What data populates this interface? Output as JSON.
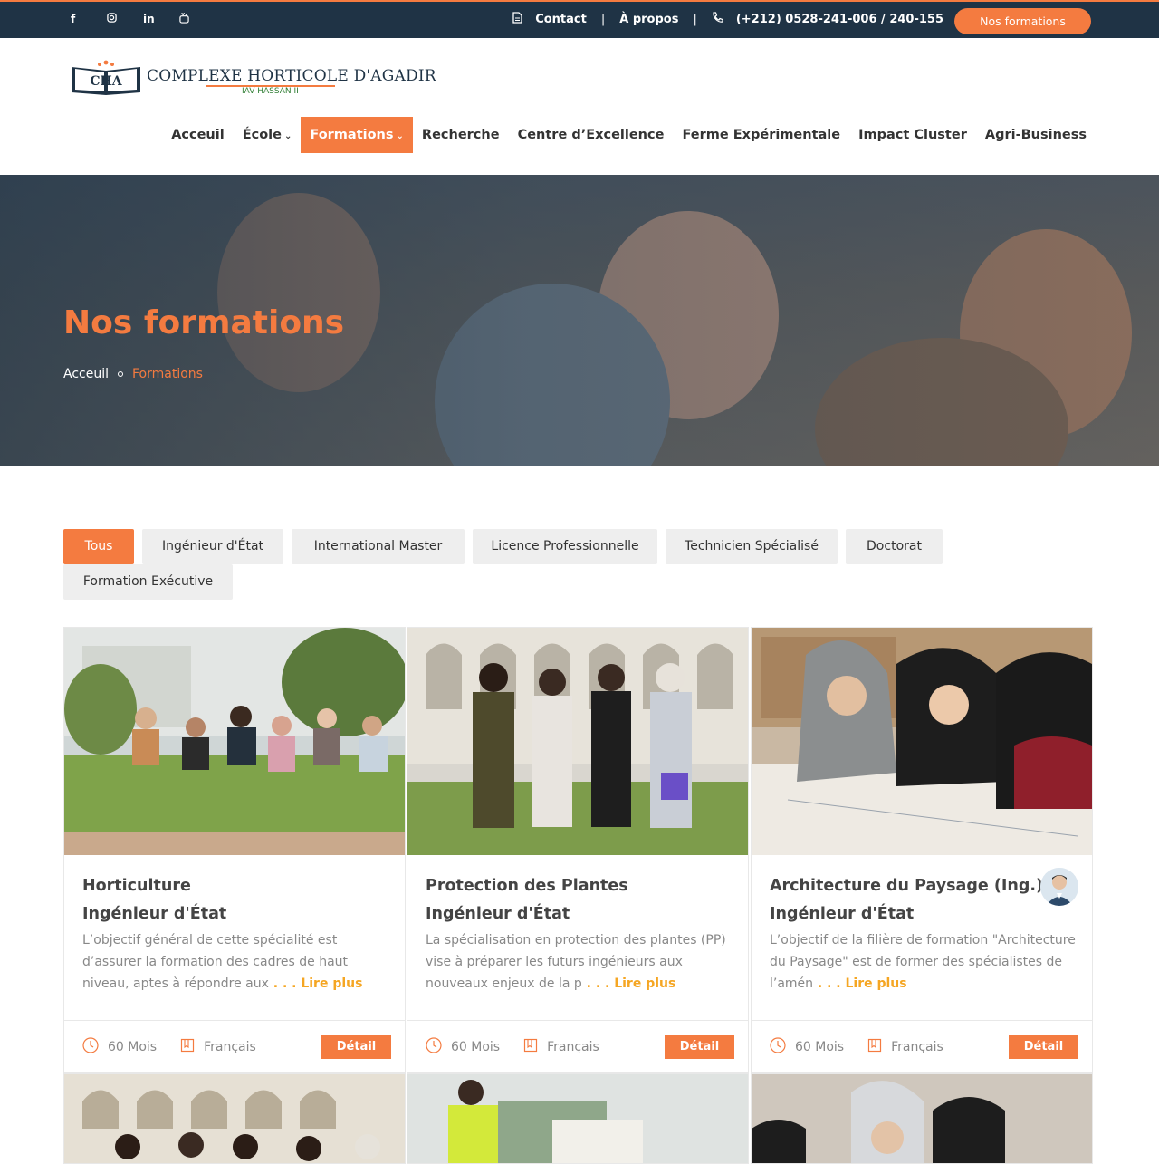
{
  "topbar": {
    "social": [
      "facebook-icon",
      "instagram-icon",
      "linkedin-icon",
      "youtube-icon"
    ],
    "contact_label": "Contact",
    "about_label": "À propos",
    "phone_label": "(+212) 0528-241-006 / 240-155",
    "separator": "|",
    "cta_label": "Nos formations"
  },
  "brand": {
    "badge": "CHA",
    "name": "COMPLEXE HORTICOLE D'AGADIR",
    "sub": "IAV HASSAN II"
  },
  "nav": {
    "items": [
      {
        "label": "Acceuil"
      },
      {
        "label": "École"
      },
      {
        "label": "Formations"
      },
      {
        "label": "Recherche"
      },
      {
        "label": "Centre d’Excellence"
      },
      {
        "label": "Ferme Expérimentale"
      },
      {
        "label": "Impact Cluster"
      },
      {
        "label": "Agri-Business"
      }
    ]
  },
  "hero": {
    "title": "Nos formations",
    "crumb_home": "Acceuil",
    "crumb_current": "Formations"
  },
  "filters": [
    "Tous",
    "Ingénieur d'État",
    "International Master",
    "Licence Professionnelle",
    "Technicien Spécialisé",
    "Doctorat",
    "Formation Exécutive"
  ],
  "cards": [
    {
      "title": "Horticulture",
      "subtitle": "Ingénieur d'État",
      "desc": "L’objectif général de cette spécialité est d’assurer la formation des cadres de haut niveau, aptes à répondre aux",
      "more": " . . . Lire plus",
      "duration": "60 Mois",
      "language": "Français",
      "button": "Détail"
    },
    {
      "title": "Protection des Plantes",
      "subtitle": "Ingénieur d'État",
      "desc": "La spécialisation en protection des plantes (PP) vise à préparer les futurs ingénieurs aux nouveaux enjeux de la p",
      "more": " . . . Lire plus",
      "duration": "60 Mois",
      "language": "Français",
      "button": "Détail"
    },
    {
      "title": "Architecture du Paysage (Ing.)",
      "subtitle": "Ingénieur d'État",
      "desc": "L’objectif de la filière de formation \"Architecture du Paysage\" est de former des spécialistes de l’amén",
      "more": " . . . Lire plus",
      "duration": "60 Mois",
      "language": "Français",
      "button": "Détail"
    }
  ],
  "colors": {
    "accent": "#f47b40",
    "dark": "#1f3345",
    "link_more": "#f5a623"
  }
}
